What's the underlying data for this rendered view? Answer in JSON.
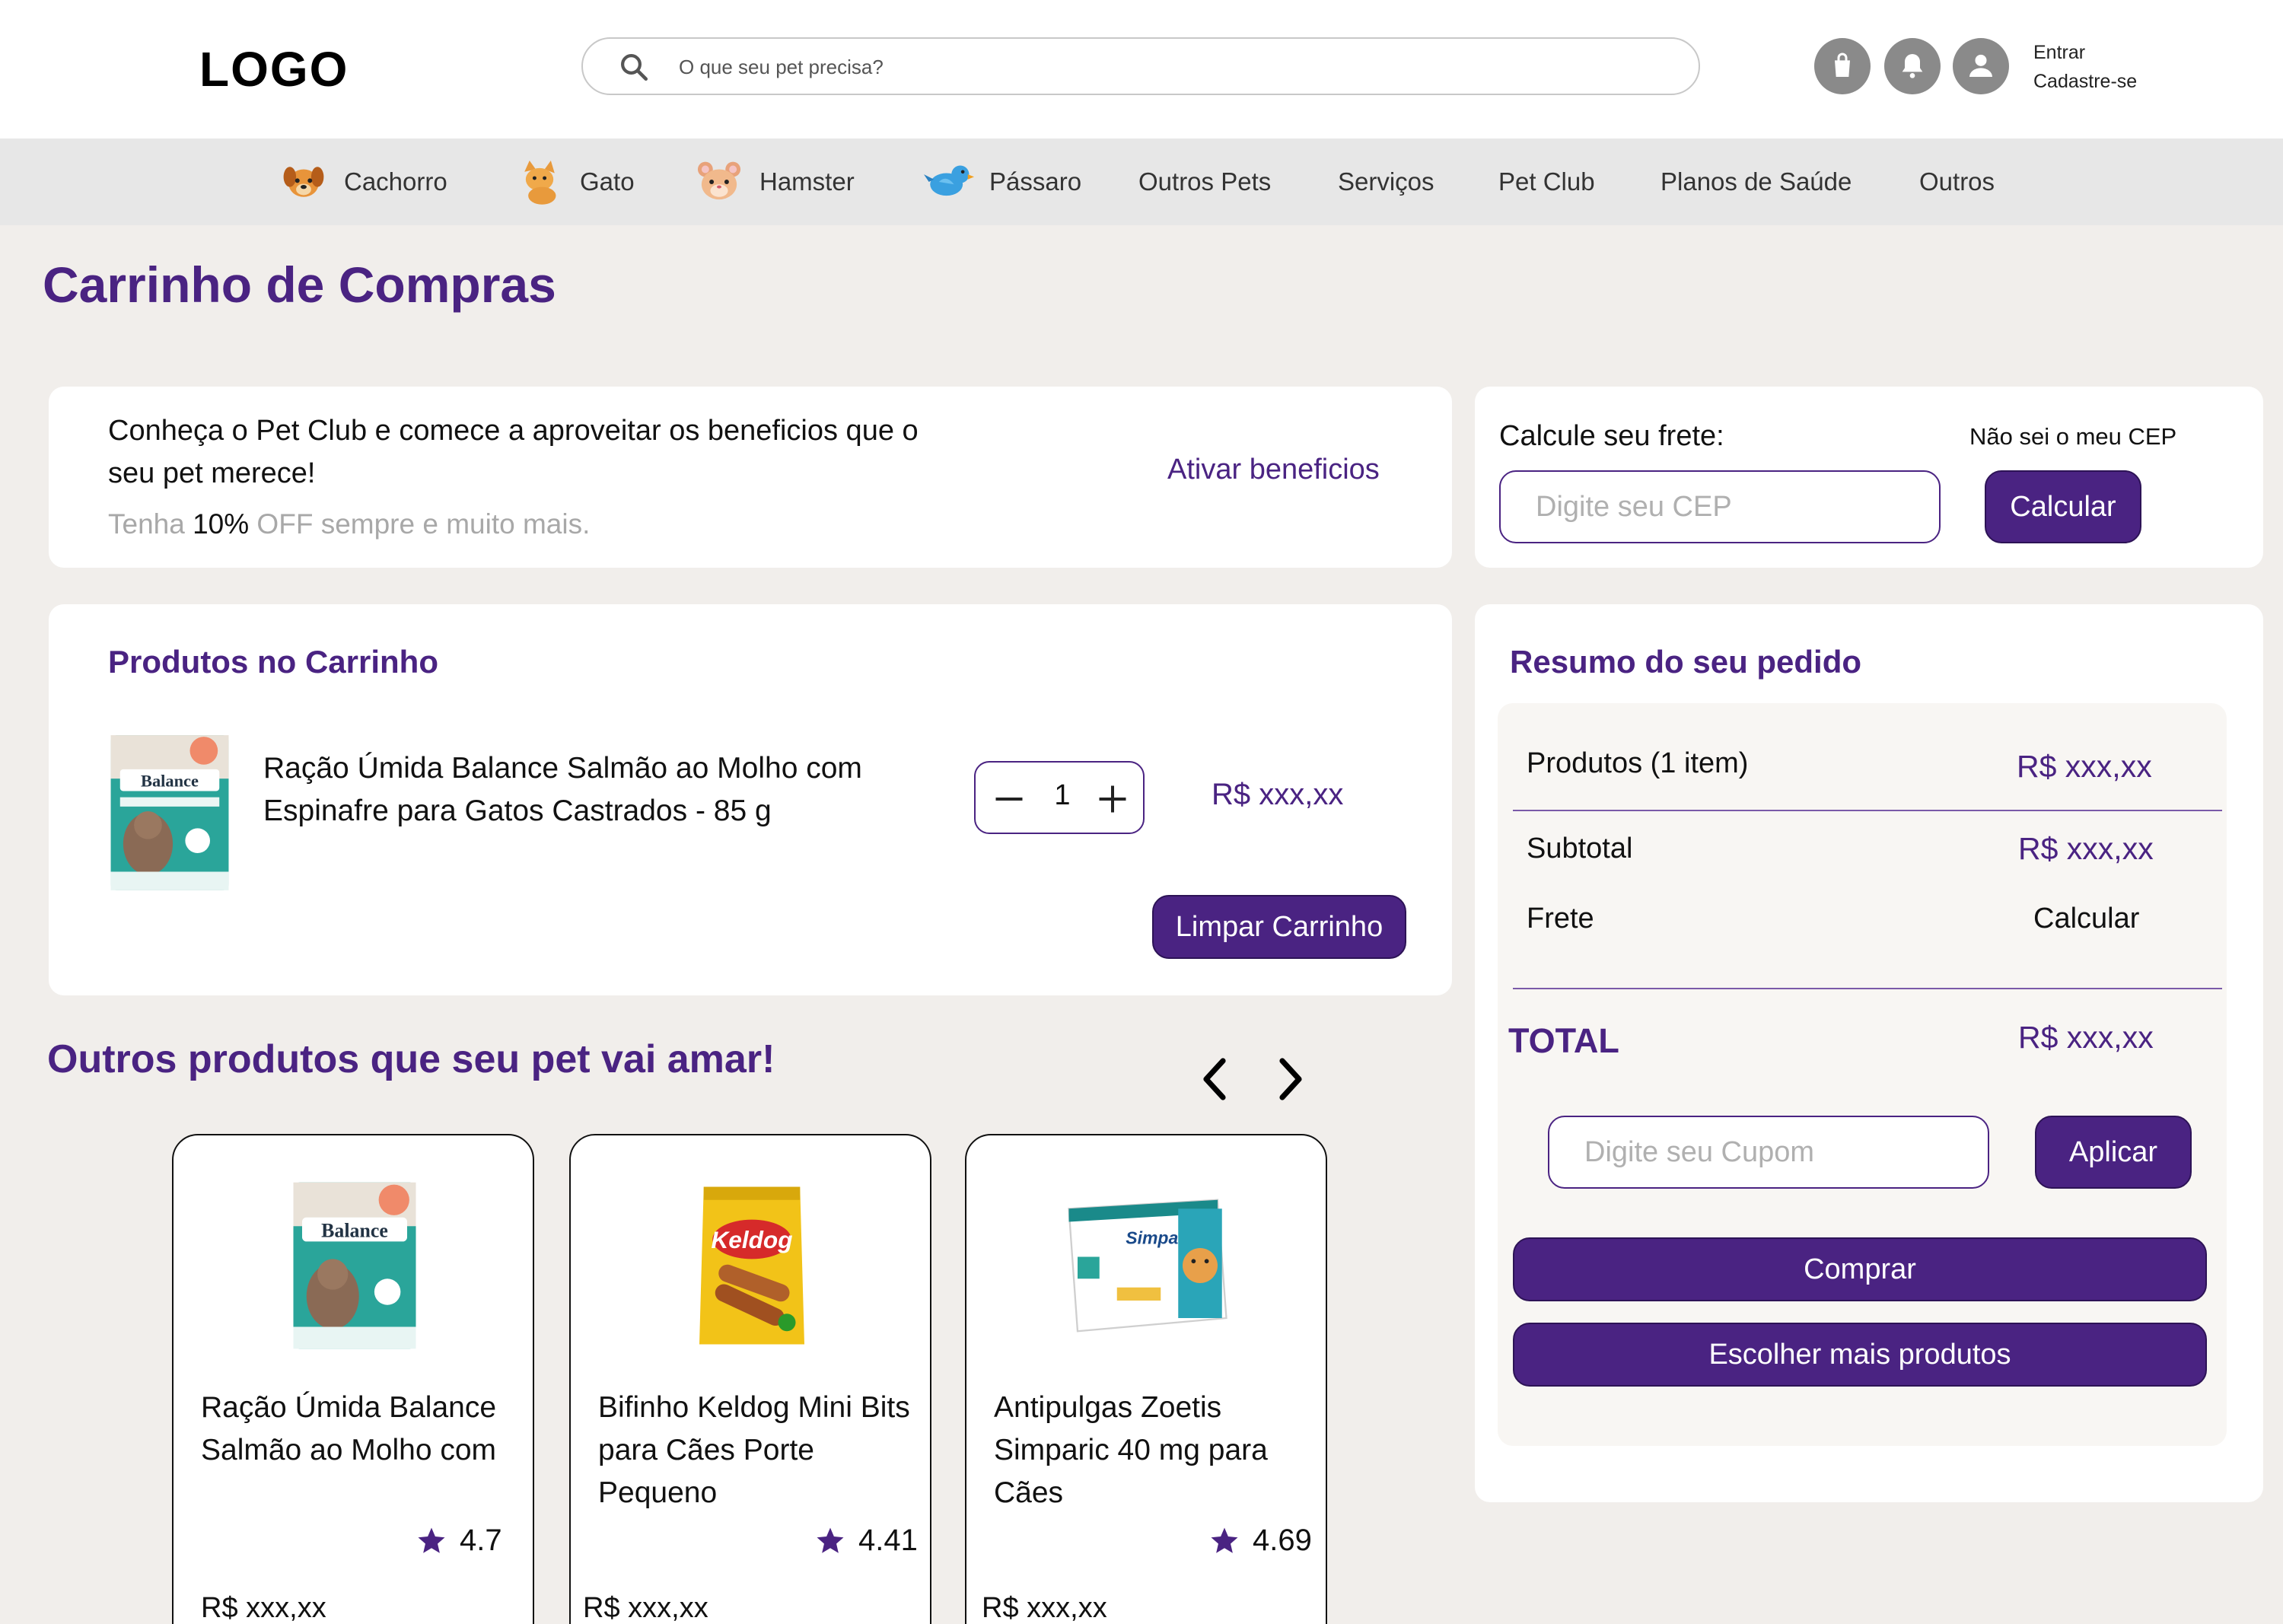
{
  "header": {
    "logo": "LOGO",
    "search_placeholder": "O que seu pet precisa?",
    "login": "Entrar",
    "signup": "Cadastre-se"
  },
  "nav": {
    "items": [
      {
        "label": "Cachorro",
        "icon": "dog-icon"
      },
      {
        "label": "Gato",
        "icon": "cat-icon"
      },
      {
        "label": "Hamster",
        "icon": "hamster-icon"
      },
      {
        "label": "Pássaro",
        "icon": "bird-icon"
      },
      {
        "label": "Outros Pets"
      },
      {
        "label": "Serviços"
      },
      {
        "label": "Pet Club"
      },
      {
        "label": "Planos de Saúde"
      },
      {
        "label": "Outros"
      }
    ]
  },
  "page_title": "Carrinho de Compras",
  "pet_club": {
    "text": "Conheça o Pet Club e comece a aproveitar os beneficios que o seu pet merece!",
    "sub_before": "Tenha ",
    "sub_highlight": "10%",
    "sub_after": " OFF sempre e muito mais.",
    "link": "Ativar beneficios"
  },
  "frete": {
    "title": "Calcule seu frete:",
    "dont_know_link": "Não sei o meu CEP",
    "cep_placeholder": "Digite seu CEP",
    "calc_button": "Calcular"
  },
  "cart": {
    "title": "Produtos no Carrinho",
    "items": [
      {
        "name": "Ração Úmida Balance Salmão ao Molho com Espinafre para Gatos Castrados - 85 g",
        "quantity": "1",
        "price": "R$ xxx,xx"
      }
    ],
    "clear_button": "Limpar Carrinho"
  },
  "summary": {
    "title": "Resumo do seu pedido",
    "products_label": "Produtos (1 item)",
    "products_value": "R$ xxx,xx",
    "subtotal_label": "Subtotal",
    "subtotal_value": "R$ xxx,xx",
    "frete_label": "Frete",
    "frete_value": "Calcular",
    "total_label": "TOTAL",
    "total_value": "R$ xxx,xx",
    "coupon_placeholder": "Digite seu Cupom",
    "apply_button": "Aplicar",
    "buy_button": "Comprar",
    "more_button": "Escolher mais produtos"
  },
  "recommendations": {
    "title": "Outros produtos que seu pet vai amar!",
    "items": [
      {
        "name": "Ração Úmida Balance Salmão ao Molho com",
        "rating": "4.7",
        "price": "R$ xxx,xx"
      },
      {
        "name": "Bifinho Keldog Mini Bits para Cães Porte Pequeno",
        "rating": "4.41",
        "price": "R$ xxx,xx"
      },
      {
        "name": "Antipulgas Zoetis Simparic 40 mg para Cães",
        "rating": "4.69",
        "price": "R$ xxx,xx"
      }
    ]
  },
  "colors": {
    "brand_purple": "#4a2382",
    "background": "#f1eeeb",
    "nav_background": "#e7e7e7"
  }
}
